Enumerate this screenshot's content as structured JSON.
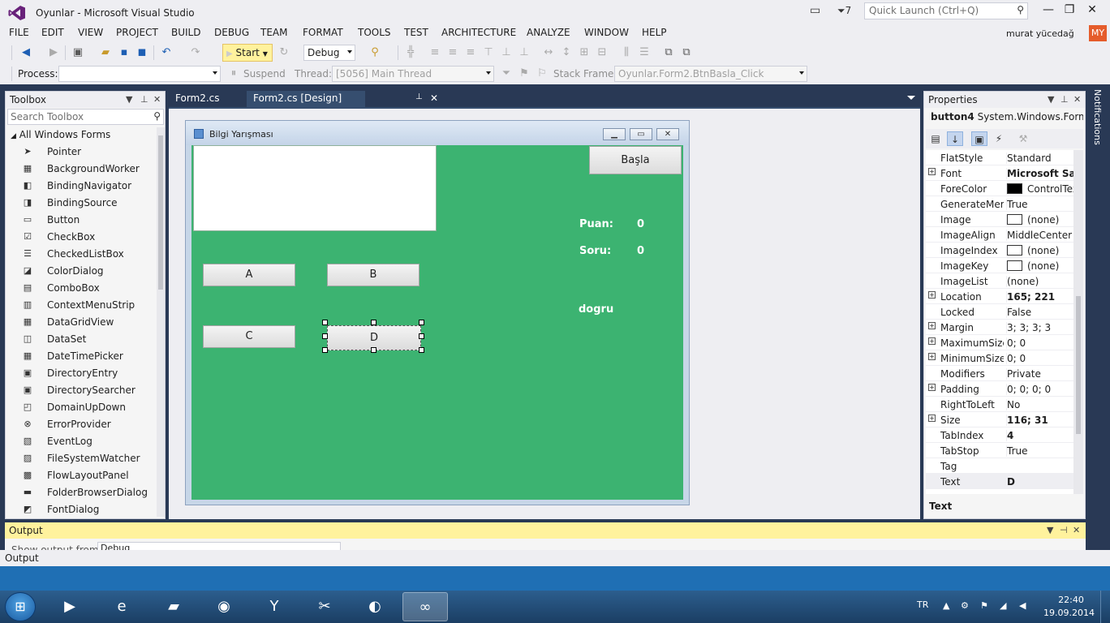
{
  "window": {
    "title": "Oyunlar - Microsoft Visual Studio",
    "notification_count": "7",
    "quick_launch_placeholder": "Quick Launch (Ctrl+Q)",
    "minimize_glyph": "—",
    "maximize_glyph": "❐",
    "close_glyph": "✕"
  },
  "menu": {
    "items": [
      "FILE",
      "EDIT",
      "VIEW",
      "PROJECT",
      "BUILD",
      "DEBUG",
      "TEAM",
      "FORMAT",
      "TOOLS",
      "TEST",
      "ARCHITECTURE",
      "ANALYZE",
      "WINDOW",
      "HELP"
    ],
    "user_name": "murat yücedağ",
    "user_initials": "MY"
  },
  "toolbar": {
    "start_label": "Start",
    "configuration": "Debug"
  },
  "debug_toolbar": {
    "process_label": "Process:",
    "suspend_label": "Suspend",
    "thread_label": "Thread:",
    "thread_value": "[5056] Main Thread",
    "stack_frame_label": "Stack Frame:",
    "stack_frame_value": "Oyunlar.Form2.BtnBasla_Click"
  },
  "toolbox": {
    "title": "Toolbox",
    "search_placeholder": "Search Toolbox",
    "category": "All Windows Forms",
    "items": [
      {
        "label": "Pointer",
        "icon": "pointer-icon",
        "glyph": "➤"
      },
      {
        "label": "BackgroundWorker",
        "icon": "backgroundworker-icon",
        "glyph": "▦"
      },
      {
        "label": "BindingNavigator",
        "icon": "bindingnavigator-icon",
        "glyph": "◧"
      },
      {
        "label": "BindingSource",
        "icon": "bindingsource-icon",
        "glyph": "◨"
      },
      {
        "label": "Button",
        "icon": "button-icon",
        "glyph": "▭"
      },
      {
        "label": "CheckBox",
        "icon": "checkbox-icon",
        "glyph": "☑"
      },
      {
        "label": "CheckedListBox",
        "icon": "checkedlistbox-icon",
        "glyph": "☰"
      },
      {
        "label": "ColorDialog",
        "icon": "colordialog-icon",
        "glyph": "◪"
      },
      {
        "label": "ComboBox",
        "icon": "combobox-icon",
        "glyph": "▤"
      },
      {
        "label": "ContextMenuStrip",
        "icon": "contextmenustrip-icon",
        "glyph": "▥"
      },
      {
        "label": "DataGridView",
        "icon": "datagridview-icon",
        "glyph": "▦"
      },
      {
        "label": "DataSet",
        "icon": "dataset-icon",
        "glyph": "◫"
      },
      {
        "label": "DateTimePicker",
        "icon": "datetimepicker-icon",
        "glyph": "▦"
      },
      {
        "label": "DirectoryEntry",
        "icon": "directoryentry-icon",
        "glyph": "▣"
      },
      {
        "label": "DirectorySearcher",
        "icon": "directorysearcher-icon",
        "glyph": "▣"
      },
      {
        "label": "DomainUpDown",
        "icon": "domainupdown-icon",
        "glyph": "◰"
      },
      {
        "label": "ErrorProvider",
        "icon": "errorprovider-icon",
        "glyph": "⊗"
      },
      {
        "label": "EventLog",
        "icon": "eventlog-icon",
        "glyph": "▧"
      },
      {
        "label": "FileSystemWatcher",
        "icon": "filesystemwatcher-icon",
        "glyph": "▨"
      },
      {
        "label": "FlowLayoutPanel",
        "icon": "flowlayoutpanel-icon",
        "glyph": "▩"
      },
      {
        "label": "FolderBrowserDialog",
        "icon": "folderbrowserdialog-icon",
        "glyph": "▬"
      },
      {
        "label": "FontDialog",
        "icon": "fontdialog-icon",
        "glyph": "◩"
      }
    ]
  },
  "documents": {
    "tabs": [
      "Form2.cs",
      "Form2.cs [Design]"
    ]
  },
  "form": {
    "title": "Bilgi Yarışması",
    "buttons": {
      "basla": "Başla",
      "a": "A",
      "b": "B",
      "c": "C",
      "d": "D"
    },
    "labels": {
      "puan": "Puan:",
      "puan_value": "0",
      "soru": "Soru:",
      "soru_value": "0",
      "dogru": "dogru"
    },
    "colors": {
      "client_background": "#3cb371"
    }
  },
  "properties": {
    "title": "Properties",
    "object_name": "button4",
    "object_type": "System.Windows.Forms",
    "rows": [
      {
        "name": "FlatStyle",
        "value": "Standard",
        "expand": false,
        "bold": false
      },
      {
        "name": "Font",
        "value": "Microsoft Sans",
        "expand": true,
        "bold": true
      },
      {
        "name": "ForeColor",
        "value": "ControlText",
        "expand": false,
        "bold": false,
        "swatch": "#000000"
      },
      {
        "name": "GenerateMem",
        "value": "True",
        "expand": false,
        "bold": false
      },
      {
        "name": "Image",
        "value": "(none)",
        "expand": false,
        "bold": false,
        "swatch": "#ffffff"
      },
      {
        "name": "ImageAlign",
        "value": "MiddleCenter",
        "expand": false,
        "bold": false
      },
      {
        "name": "ImageIndex",
        "value": "(none)",
        "expand": false,
        "bold": false,
        "swatch": "#ffffff"
      },
      {
        "name": "ImageKey",
        "value": "(none)",
        "expand": false,
        "bold": false,
        "swatch": "#ffffff"
      },
      {
        "name": "ImageList",
        "value": "(none)",
        "expand": false,
        "bold": false
      },
      {
        "name": "Location",
        "value": "165; 221",
        "expand": true,
        "bold": true
      },
      {
        "name": "Locked",
        "value": "False",
        "expand": false,
        "bold": false
      },
      {
        "name": "Margin",
        "value": "3; 3; 3; 3",
        "expand": true,
        "bold": false
      },
      {
        "name": "MaximumSize",
        "value": "0; 0",
        "expand": true,
        "bold": false
      },
      {
        "name": "MinimumSize",
        "value": "0; 0",
        "expand": true,
        "bold": false
      },
      {
        "name": "Modifiers",
        "value": "Private",
        "expand": false,
        "bold": false
      },
      {
        "name": "Padding",
        "value": "0; 0; 0; 0",
        "expand": true,
        "bold": false
      },
      {
        "name": "RightToLeft",
        "value": "No",
        "expand": false,
        "bold": false
      },
      {
        "name": "Size",
        "value": "116; 31",
        "expand": true,
        "bold": true
      },
      {
        "name": "TabIndex",
        "value": "4",
        "expand": false,
        "bold": true
      },
      {
        "name": "TabStop",
        "value": "True",
        "expand": false,
        "bold": false
      },
      {
        "name": "Tag",
        "value": "",
        "expand": false,
        "bold": false
      },
      {
        "name": "Text",
        "value": "D",
        "expand": false,
        "bold": true,
        "selected": true
      }
    ],
    "description_title": "Text"
  },
  "side": {
    "notifications": "Notifications"
  },
  "output": {
    "title": "Output",
    "show_from_label": "Show output from:",
    "show_from_value": "Debug",
    "tab_label": "Output"
  },
  "taskbar": {
    "apps": [
      {
        "icon": "media-player-icon",
        "glyph": "▶"
      },
      {
        "icon": "internet-explorer-icon",
        "glyph": "e"
      },
      {
        "icon": "file-explorer-icon",
        "glyph": "▰"
      },
      {
        "icon": "chrome-icon",
        "glyph": "◉"
      },
      {
        "icon": "yandex-icon",
        "glyph": "Y"
      },
      {
        "icon": "tools-icon",
        "glyph": "✂"
      },
      {
        "icon": "obs-icon",
        "glyph": "◐"
      },
      {
        "icon": "visual-studio-icon",
        "glyph": "∞"
      }
    ],
    "language": "TR",
    "time": "22:40",
    "date": "19.09.2014"
  }
}
